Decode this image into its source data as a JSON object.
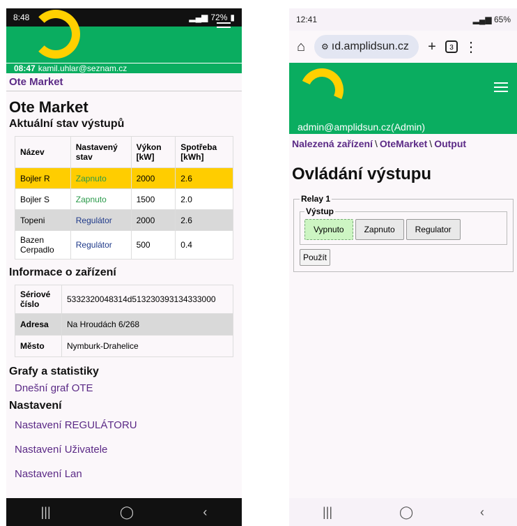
{
  "left": {
    "status": {
      "time": "8:48",
      "battery": "72%"
    },
    "user": {
      "time": "08:47",
      "email": "kamil.uhlar@seznam.cz"
    },
    "breadcrumb": "Ote Market",
    "title": "Ote Market",
    "subtitle": "Aktuální stav výstupů",
    "outputs": {
      "headers": [
        "Název",
        "Nastavený stav",
        "Výkon [kW]",
        "Spotřeba [kWh]"
      ],
      "rows": [
        [
          "Bojler R",
          "Zapnuto",
          "2000",
          "2.6"
        ],
        [
          "Bojler S",
          "Zapnuto",
          "1500",
          "2.0"
        ],
        [
          "Topeni",
          "Regulátor",
          "2000",
          "2.6"
        ],
        [
          "Bazen Cerpadlo",
          "Regulátor",
          "500",
          "0.4"
        ]
      ]
    },
    "device_heading": "Informace o zařízení",
    "device": [
      [
        "Sériové číslo",
        "5332320048314d513230393134333000"
      ],
      [
        "Adresa",
        "Na Hroudách 6/268"
      ],
      [
        "Město",
        "Nymburk-Drahelice"
      ]
    ],
    "charts_heading": "Grafy a statistiky",
    "charts_link": "Dnešní graf OTE",
    "settings_heading": "Nastavení",
    "settings_links": [
      "Nastavení REGULÁTORU",
      "Nastavení Uživatele",
      "Nastavení Lan"
    ]
  },
  "right": {
    "status": {
      "time": "12:41",
      "battery": "65%"
    },
    "url": "ıd.amplidsun.cz",
    "tabs_count": "3",
    "user": "admin@amplidsun.cz(Admin)",
    "breadcrumb": [
      "Nalezená zařízení",
      "OteMarket",
      "Output"
    ],
    "title": "Ovládání výstupu",
    "relay_legend": "Relay 1",
    "output_legend": "Výstup",
    "buttons": [
      "Vypnuto",
      "Zapnuto",
      "Regulator"
    ],
    "apply": "Použít"
  },
  "colors": {
    "brand_green": "#0aad60",
    "logo_yellow": "#ffd000",
    "link_purple": "#5b2a86"
  }
}
